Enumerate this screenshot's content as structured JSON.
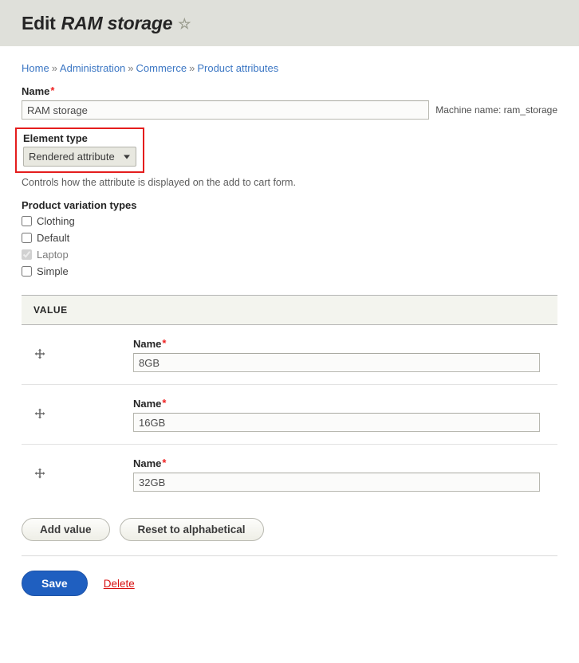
{
  "header": {
    "title_prefix": "Edit",
    "title_entity": "RAM storage",
    "flag_icon": "star-outline-icon",
    "background": "#dfe0da"
  },
  "breadcrumb": {
    "separator": "»",
    "items": [
      {
        "label": "Home"
      },
      {
        "label": "Administration"
      },
      {
        "label": "Commerce"
      },
      {
        "label": "Product attributes"
      }
    ]
  },
  "form": {
    "name_field": {
      "label": "Name",
      "required_marker": "*",
      "value": "RAM storage",
      "placeholder": "",
      "machine_name": "Machine name: ram_storage"
    },
    "element_type": {
      "label": "Element type",
      "selected": "Rendered attribute",
      "options": [
        "Rendered attribute"
      ],
      "description": "Controls how the attribute is displayed on the add to cart form.",
      "highlight_color": "#e41d1d"
    },
    "variation_types": {
      "label": "Product variation types",
      "items": [
        {
          "label": "Clothing",
          "checked": false,
          "disabled": false
        },
        {
          "label": "Default",
          "checked": false,
          "disabled": false
        },
        {
          "label": "Laptop",
          "checked": true,
          "disabled": true
        },
        {
          "label": "Simple",
          "checked": false,
          "disabled": false
        }
      ]
    }
  },
  "values_table": {
    "column_header": "VALUE",
    "drag_icon": "drag-move-icon",
    "rows": [
      {
        "label": "Name",
        "required_marker": "*",
        "value": "8GB"
      },
      {
        "label": "Name",
        "required_marker": "*",
        "value": "16GB"
      },
      {
        "label": "Name",
        "required_marker": "*",
        "value": "32GB"
      }
    ]
  },
  "actions": {
    "add_value": "Add value",
    "reset_alphabetical": "Reset to alphabetical",
    "save": "Save",
    "delete": "Delete",
    "save_color": "#1f5fc0",
    "delete_color": "#d81010"
  }
}
